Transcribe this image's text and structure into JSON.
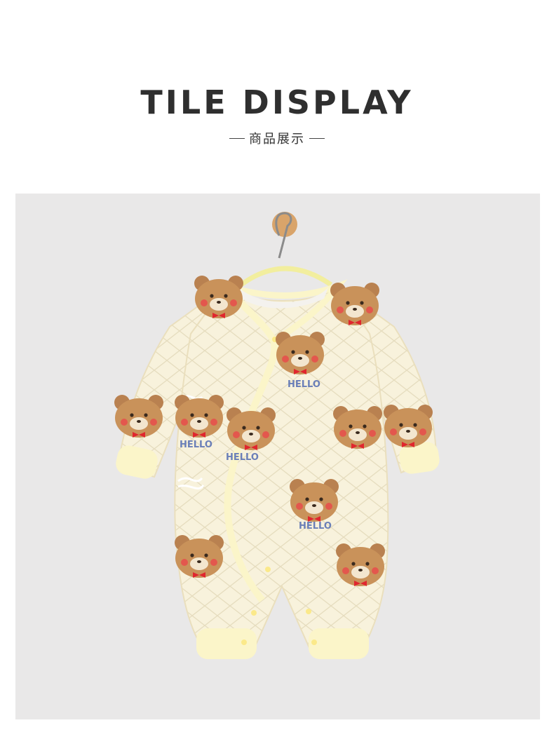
{
  "header": {
    "title": "TILE DISPLAY",
    "subtitle": "商品展示"
  },
  "product_photo": {
    "subject": "baby-romper-on-hanger",
    "print_text": "HELLO",
    "colors": {
      "background": "#e9e8e8",
      "fabric": "#f8f2dc",
      "trim": "#fbf5c9",
      "bear": "#c9925a",
      "bow": "#e0262e",
      "hanger": "#d9a46a"
    }
  }
}
